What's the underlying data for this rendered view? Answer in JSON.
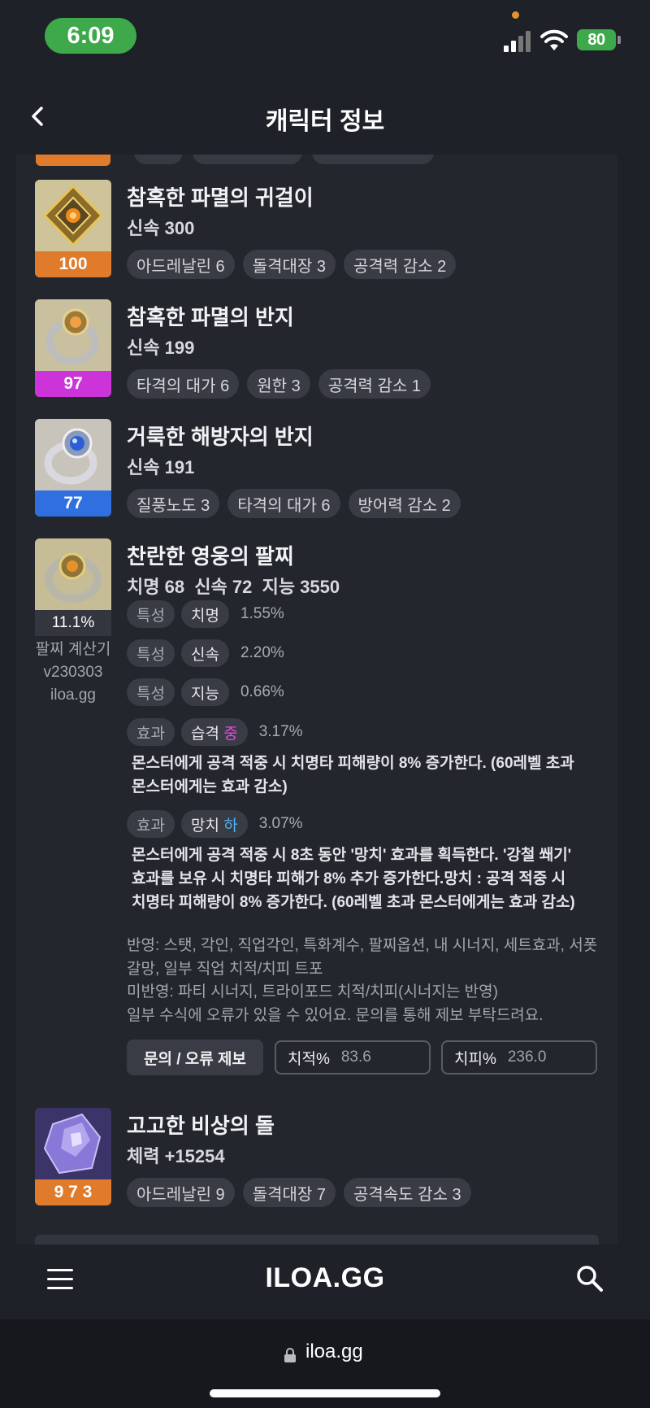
{
  "status_bar": {
    "time": "6:09",
    "battery": "80"
  },
  "header": {
    "title": "캐릭터 정보"
  },
  "items": [
    {
      "name": "참혹한 파멸의 귀걸이",
      "stat": "신속 300",
      "quality": "100",
      "quality_color": "#e07b2c",
      "tags": [
        "아드레날린 6",
        "돌격대장 3",
        "공격력 감소 2"
      ]
    },
    {
      "name": "참혹한 파멸의 반지",
      "stat": "신속 199",
      "quality": "97",
      "quality_color": "#cc33d9",
      "tags": [
        "타격의 대가 6",
        "원한 3",
        "공격력 감소 1"
      ]
    },
    {
      "name": "거룩한 해방자의 반지",
      "stat": "신속 191",
      "quality": "77",
      "quality_color": "#2f6fe0",
      "tags": [
        "질풍노도 3",
        "타격의 대가 6",
        "방어력 감소 2"
      ]
    }
  ],
  "bracelet": {
    "name": "찬란한 영웅의 팔찌",
    "stats": "치명 68  신속 72  지능 3550",
    "percent": "11.1%",
    "calc_note": [
      "팔찌 계산기",
      "v230303",
      "iloa.gg"
    ],
    "traits": [
      {
        "label": "특성",
        "value": "치명",
        "pct": "1.55%"
      },
      {
        "label": "특성",
        "value": "신속",
        "pct": "2.20%"
      },
      {
        "label": "특성",
        "value": "지능",
        "pct": "0.66%"
      }
    ],
    "effects": [
      {
        "label": "효과",
        "value": "습격",
        "grade": "중",
        "grade_color": "#e04ce0",
        "pct": "3.17%",
        "desc": [
          "몬스터에게 공격 적중 시 치명타 피해량이 8% 증가한다. (60레벨 초과",
          "몬스터에게는 효과 감소)"
        ]
      },
      {
        "label": "효과",
        "value": "망치",
        "grade": "하",
        "grade_color": "#4cb3f0",
        "pct": "3.07%",
        "desc": [
          "몬스터에게 공격 적중 시 8초 동안 '망치' 효과를 획득한다. '강철 쐐기'",
          "효과를 보유 시 치명타 피해가 8% 추가 증가한다.망치 : 공격 적중 시",
          "치명타 피해량이 8% 증가한다. (60레벨 초과 몬스터에게는 효과 감소)"
        ]
      }
    ],
    "notes": [
      "반영: 스탯, 각인, 직업각인, 특화계수, 팔찌옵션, 내 시너지, 세트효과, 서폿",
      "갈망, 일부 직업 치적/치피 트포",
      "미반영: 파티 시너지, 트라이포드 치적/치피(시너지는 반영)",
      "일부 수식에 오류가 있을 수 있어요. 문의를 통해 제보 부탁드려요."
    ],
    "report_button": "문의 / 오류 제보",
    "crit_rate_label": "치적%",
    "crit_rate_value": "83.6",
    "crit_dmg_label": "치피%",
    "crit_dmg_value": "236.0"
  },
  "stone": {
    "name": "고고한 비상의 돌",
    "stat": "체력 +15254",
    "quality": "9 7 3",
    "quality_color": "#e07b2c",
    "tags": [
      "아드레날린 9",
      "돌격대장 7",
      "공격속도 감소 3"
    ]
  },
  "navbar": {
    "logo": "ILOA.GG"
  },
  "browser": {
    "url": "iloa.gg"
  }
}
